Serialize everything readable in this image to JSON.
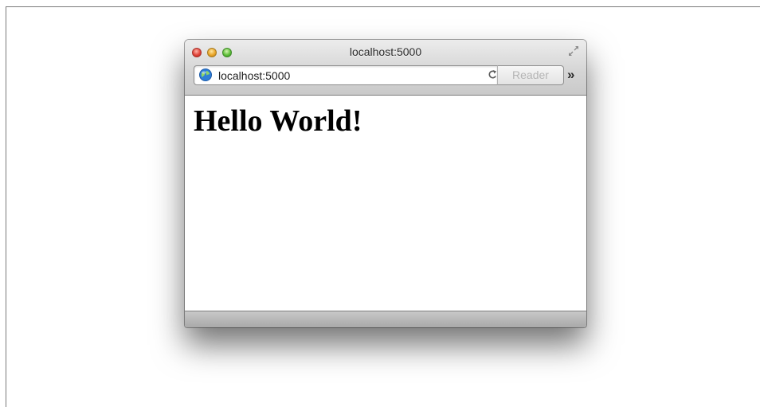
{
  "window": {
    "title": "localhost:5000"
  },
  "toolbar": {
    "address": "localhost:5000",
    "reader_label": "Reader",
    "overflow_label": "»",
    "reload_icon": "reload-icon",
    "site_icon": "globe-icon"
  },
  "page": {
    "heading": "Hello World!"
  },
  "colors": {
    "close": "#e0443a",
    "minimize": "#e9a629",
    "maximize": "#5fbf3a",
    "titlebar": "#d6d6d6",
    "reader_text": "#b4b4b4"
  }
}
